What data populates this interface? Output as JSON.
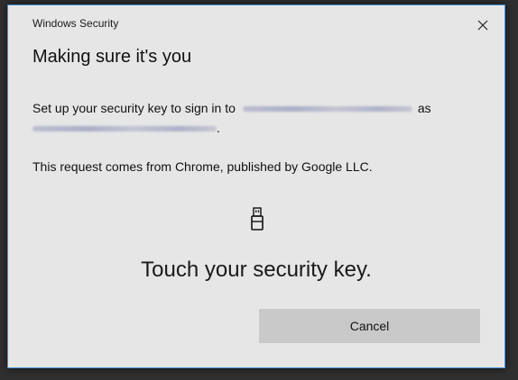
{
  "window": {
    "title": "Windows Security",
    "close_glyph": "✕"
  },
  "dialog": {
    "heading": "Making sure it's you",
    "message_prefix": "Set up your security key to sign in to",
    "message_as": "as",
    "message_end": ".",
    "origin_text": "This request comes from Chrome, published by Google LLC.",
    "icon": "usb-security-key-icon",
    "instruction": "Touch your security key.",
    "cancel_label": "Cancel"
  },
  "colors": {
    "dialog_background": "#e6e6e6",
    "button_background": "#c9c9c9",
    "border_accent": "#4a90d9"
  }
}
